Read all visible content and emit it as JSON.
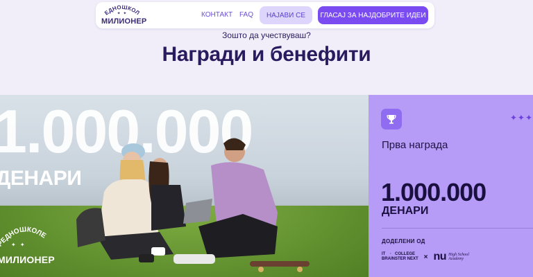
{
  "header": {
    "logo_top": "СРЕДНОШКОЛЕЦ",
    "logo_stars": "✦ ✦",
    "logo_word": "МИЛИОНЕР",
    "nav": {
      "contact": "КОНТАКТ",
      "faq": "FAQ"
    },
    "login_button": "НАЈАВИ СЕ",
    "vote_button": "ГЛАСАЈ ЗА НАЈДОБРИТЕ ИДЕИ"
  },
  "section": {
    "eyebrow": "Зошто да учествуваш?",
    "title": "Награди и бенефити"
  },
  "hero": {
    "big_amount": "1.000.000",
    "unit": "ДЕНАРИ",
    "logo_top": "СРЕДНОШКОЛЕЦ",
    "logo_stars": "✦ ✦",
    "logo_word": "МИЛИОНЕР"
  },
  "prize": {
    "sparkles": "✦✦✦",
    "title": "Прва награда",
    "amount": "1.000.000",
    "unit": "ДЕНАРИ",
    "awarded_label": "ДОДЕЛЕНИ ОД",
    "sponsor1_line1": "IT    ·   COLLEGE",
    "sponsor1_line2": "BRAINSTER NEXT",
    "separator": "×",
    "sponsor2_mark": "nu",
    "sponsor2_line1": "High School",
    "sponsor2_line2": "Academy"
  },
  "colors": {
    "accent": "#7a4bf0",
    "accent_light": "#ddd5fb",
    "prize_bg": "#b79cf7",
    "text_dark": "#2a1b5e"
  },
  "icons": {
    "trophy": "trophy-icon"
  }
}
